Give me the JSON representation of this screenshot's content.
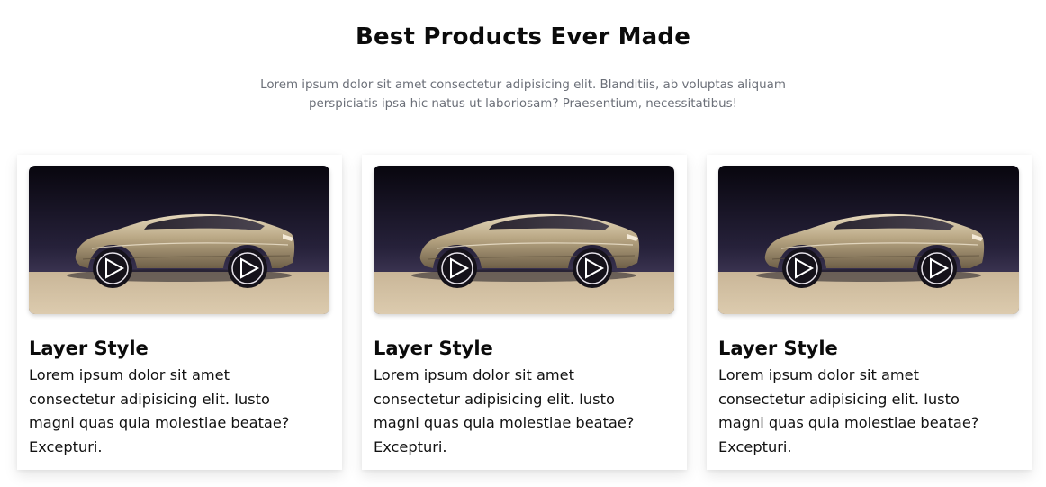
{
  "section": {
    "title": "Best Products Ever Made",
    "subtitle": "Lorem ipsum dolor sit amet consectetur adipisicing elit. Blanditiis, ab voluptas aliquam perspiciatis ipsa hic natus ut laboriosam? Praesentium, necessitatibus!"
  },
  "cards": [
    {
      "title": "Layer Style",
      "text": "Lorem ipsum dolor sit amet consectetur adipisicing elit. Iusto magni quas quia molestiae beatae? Excepturi."
    },
    {
      "title": "Layer Style",
      "text": "Lorem ipsum dolor sit amet consectetur adipisicing elit. Iusto magni quas quia molestiae beatae? Excepturi."
    },
    {
      "title": "Layer Style",
      "text": "Lorem ipsum dolor sit amet consectetur adipisicing elit. Iusto magni quas quia molestiae beatae? Excepturi."
    }
  ],
  "colors": {
    "image_background_top": "#0c0a14",
    "image_background_mid": "#2a2540",
    "image_floor": "#d5c3a5",
    "car_body": "#b9a887",
    "subtitle_text": "#6b6f78"
  }
}
